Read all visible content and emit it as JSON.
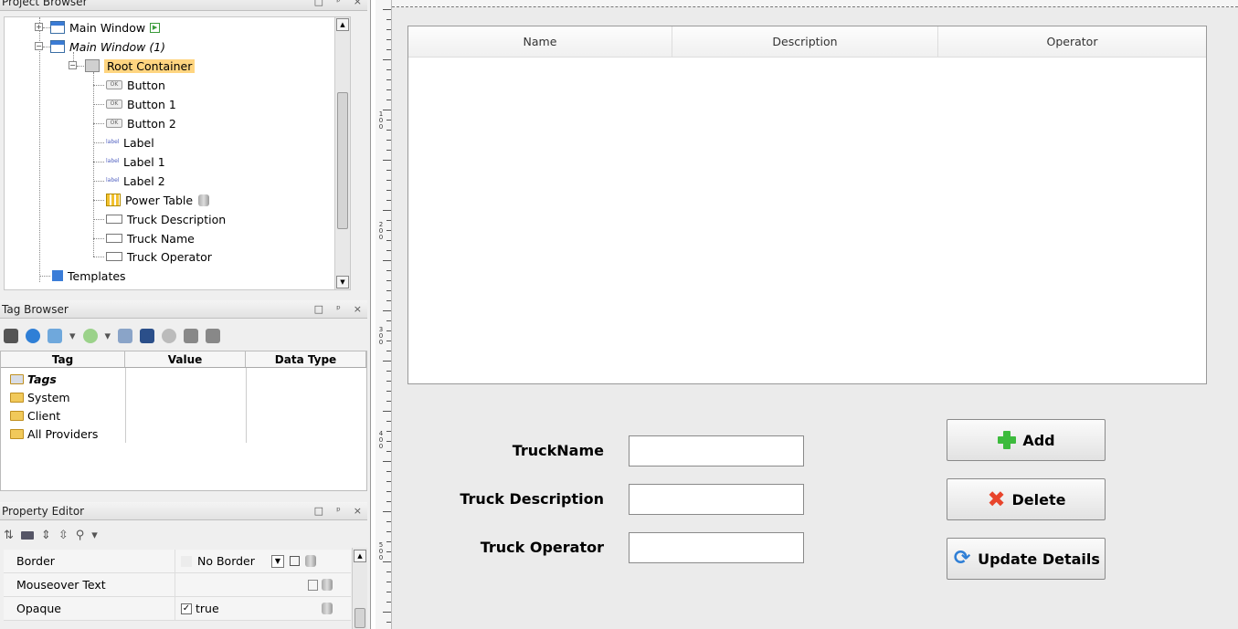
{
  "project_browser": {
    "title": "Project Browser",
    "items": {
      "main_window": "Main Window",
      "main_window_1": "Main Window (1)",
      "root_container": "Root Container",
      "button": "Button",
      "button_1": "Button 1",
      "button_2": "Button 2",
      "label": "Label",
      "label_1": "Label 1",
      "label_2": "Label 2",
      "power_table": "Power Table",
      "truck_description": "Truck Description",
      "truck_name": "Truck Name",
      "truck_operator": "Truck Operator",
      "templates": "Templates"
    }
  },
  "tag_browser": {
    "title": "Tag Browser",
    "columns": [
      "Tag",
      "Value",
      "Data Type"
    ],
    "rows": [
      "Tags",
      "System",
      "Client",
      "All Providers"
    ]
  },
  "property_editor": {
    "title": "Property Editor",
    "rows": [
      {
        "name": "Border",
        "value": "No Border"
      },
      {
        "name": "Mouseover Text",
        "value": ""
      },
      {
        "name": "Opaque",
        "value": "true"
      }
    ]
  },
  "ruler": {
    "labels": [
      "1\n0\n0",
      "2\n0\n0",
      "3\n0\n0",
      "4\n0\n0",
      "5\n0\n0"
    ]
  },
  "designer": {
    "table_columns": [
      "Name",
      "Description",
      "Operator"
    ],
    "labels": {
      "truck_name": "TruckName",
      "truck_description": "Truck Description",
      "truck_operator": "Truck Operator"
    },
    "buttons": {
      "add": "Add",
      "delete": "Delete",
      "update": "Update Details"
    }
  },
  "colors": {
    "selection": "#ffd580",
    "add_icon": "#3dbb3d",
    "delete_icon": "#e8452c",
    "update_icon": "#2f7fd6"
  }
}
